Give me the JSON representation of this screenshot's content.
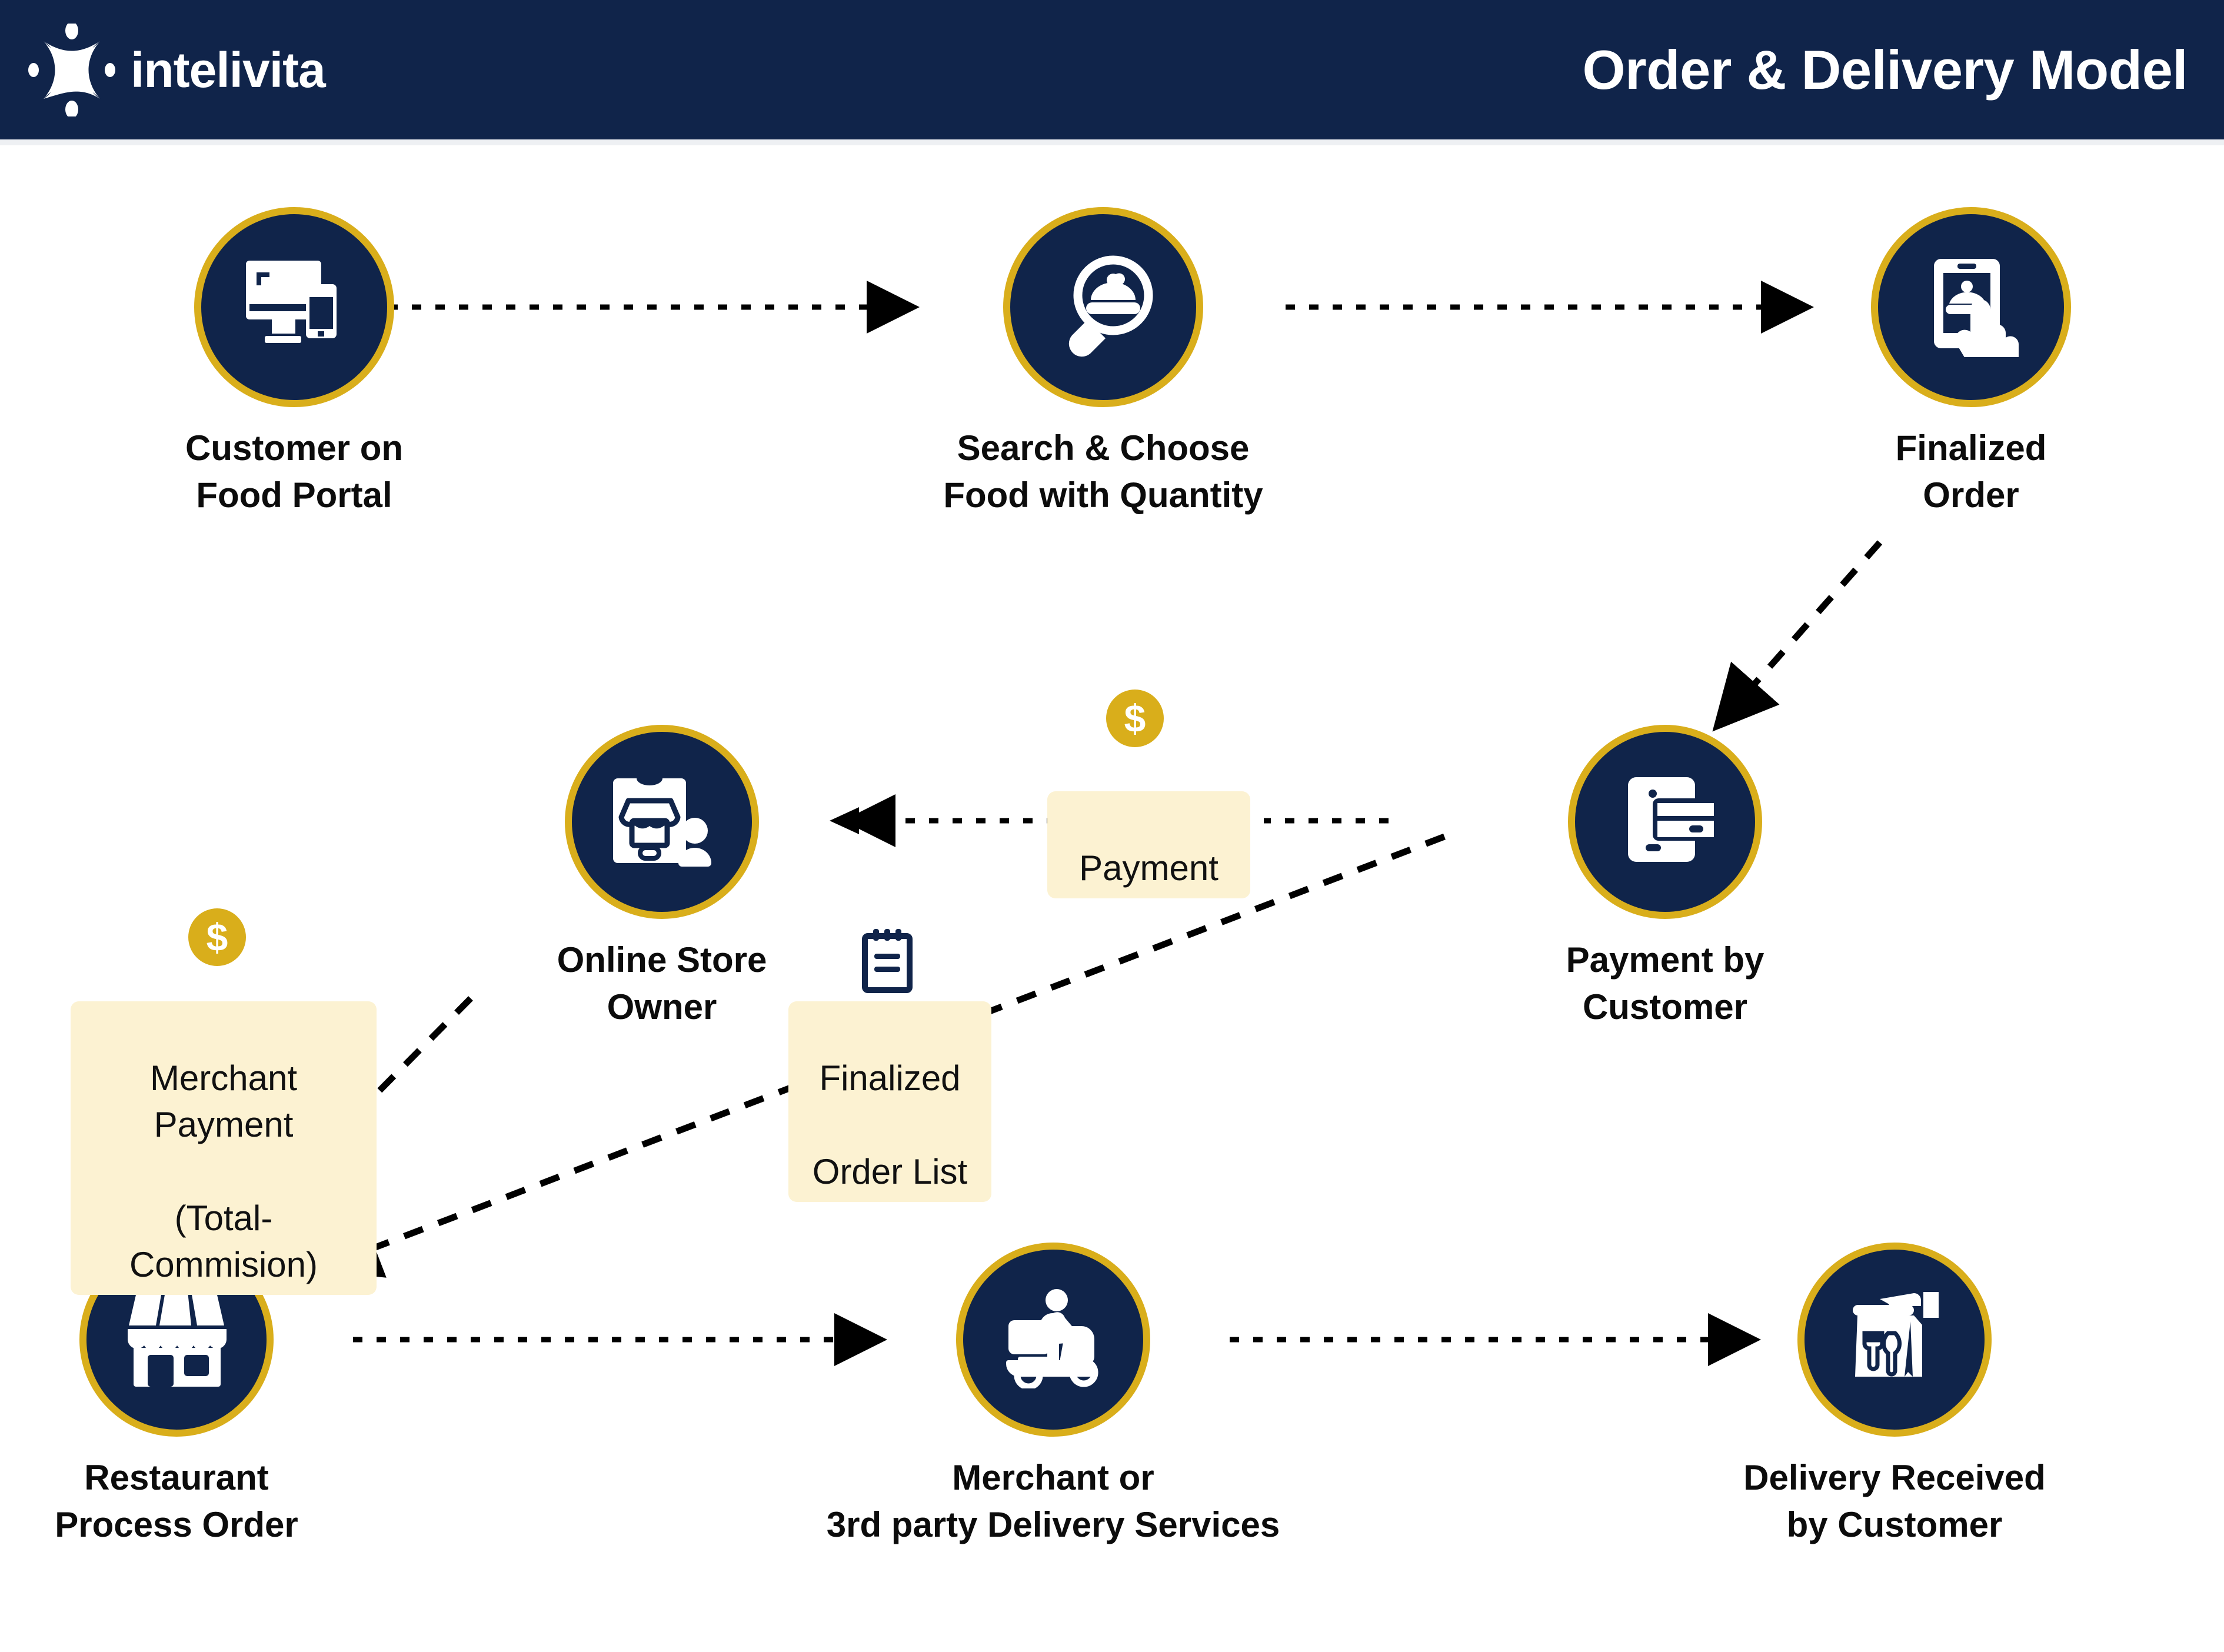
{
  "header": {
    "brand_name": "intelivita",
    "logo_icon": "intelivita-x-logo-icon",
    "title": "Order & Delivery Model"
  },
  "colors": {
    "navy": "#10244a",
    "gold": "#d9ae1b",
    "tag_bg": "#fcf2d2",
    "page_bg": "#ffffff",
    "text": "#0c0c0c"
  },
  "diagram": {
    "type": "flow",
    "nodes": [
      {
        "id": "customer_portal",
        "icon": "desktop-mobile-icon",
        "label": "Customer on\nFood Portal",
        "label_line1": "Customer on",
        "label_line2": "Food Portal"
      },
      {
        "id": "search_choose",
        "icon": "search-food-icon",
        "label": "Search & Choose\nFood with Quantity",
        "label_line1": "Search & Choose",
        "label_line2": "Food with Quantity"
      },
      {
        "id": "finalized_order",
        "icon": "mobile-tap-food-icon",
        "label": "Finalized\nOrder",
        "label_line1": "Finalized",
        "label_line2": "Order"
      },
      {
        "id": "store_owner",
        "icon": "mobile-store-person-icon",
        "label": "Online Store\nOwner",
        "label_line1": "Online Store",
        "label_line2": "Owner"
      },
      {
        "id": "payment_customer",
        "icon": "mobile-card-payment-icon",
        "label": "Payment by\nCustomer",
        "label_line1": "Payment by",
        "label_line2": "Customer"
      },
      {
        "id": "restaurant",
        "icon": "storefront-icon",
        "label": "Restaurant\nProcess Order",
        "label_line1": "Restaurant",
        "label_line2": "Process Order"
      },
      {
        "id": "delivery_service",
        "icon": "scooter-delivery-icon",
        "label": "Merchant or\n3rd party Delivery Services",
        "label_line1": "Merchant or",
        "label_line2": "3rd party Delivery Services"
      },
      {
        "id": "delivery_received",
        "icon": "hand-food-bag-icon",
        "label": "Delivery Received\nby Customer",
        "label_line1": "Delivery Received",
        "label_line2": "by Customer"
      }
    ],
    "tags": [
      {
        "id": "payment_tag",
        "text": "Payment",
        "icon": "dollar-coin-icon"
      },
      {
        "id": "merchant_payment_tag",
        "text": "Merchant Payment\n(Total-Commision)",
        "line1": "Merchant Payment",
        "line2": "(Total-Commision)",
        "icon": "dollar-coin-icon"
      },
      {
        "id": "order_list_tag",
        "text": "Finalized\nOrder List",
        "line1": "Finalized",
        "line2": "Order List",
        "icon": "notepad-list-icon"
      }
    ],
    "coin_symbol": "$",
    "edges": [
      {
        "from": "customer_portal",
        "to": "search_choose",
        "style": "dotted",
        "label": ""
      },
      {
        "from": "search_choose",
        "to": "finalized_order",
        "style": "dotted",
        "label": ""
      },
      {
        "from": "finalized_order",
        "to": "payment_customer",
        "style": "dashed",
        "label": ""
      },
      {
        "from": "payment_customer",
        "to": "store_owner",
        "style": "dotted",
        "label": "Payment"
      },
      {
        "from": "payment_customer",
        "to": "restaurant",
        "style": "dashed",
        "label": "Finalized Order List"
      },
      {
        "from": "store_owner",
        "to": "restaurant",
        "style": "dashed",
        "label": "Merchant Payment (Total-Commision)"
      },
      {
        "from": "restaurant",
        "to": "delivery_service",
        "style": "dotted",
        "label": ""
      },
      {
        "from": "delivery_service",
        "to": "delivery_received",
        "style": "dotted",
        "label": ""
      }
    ]
  }
}
